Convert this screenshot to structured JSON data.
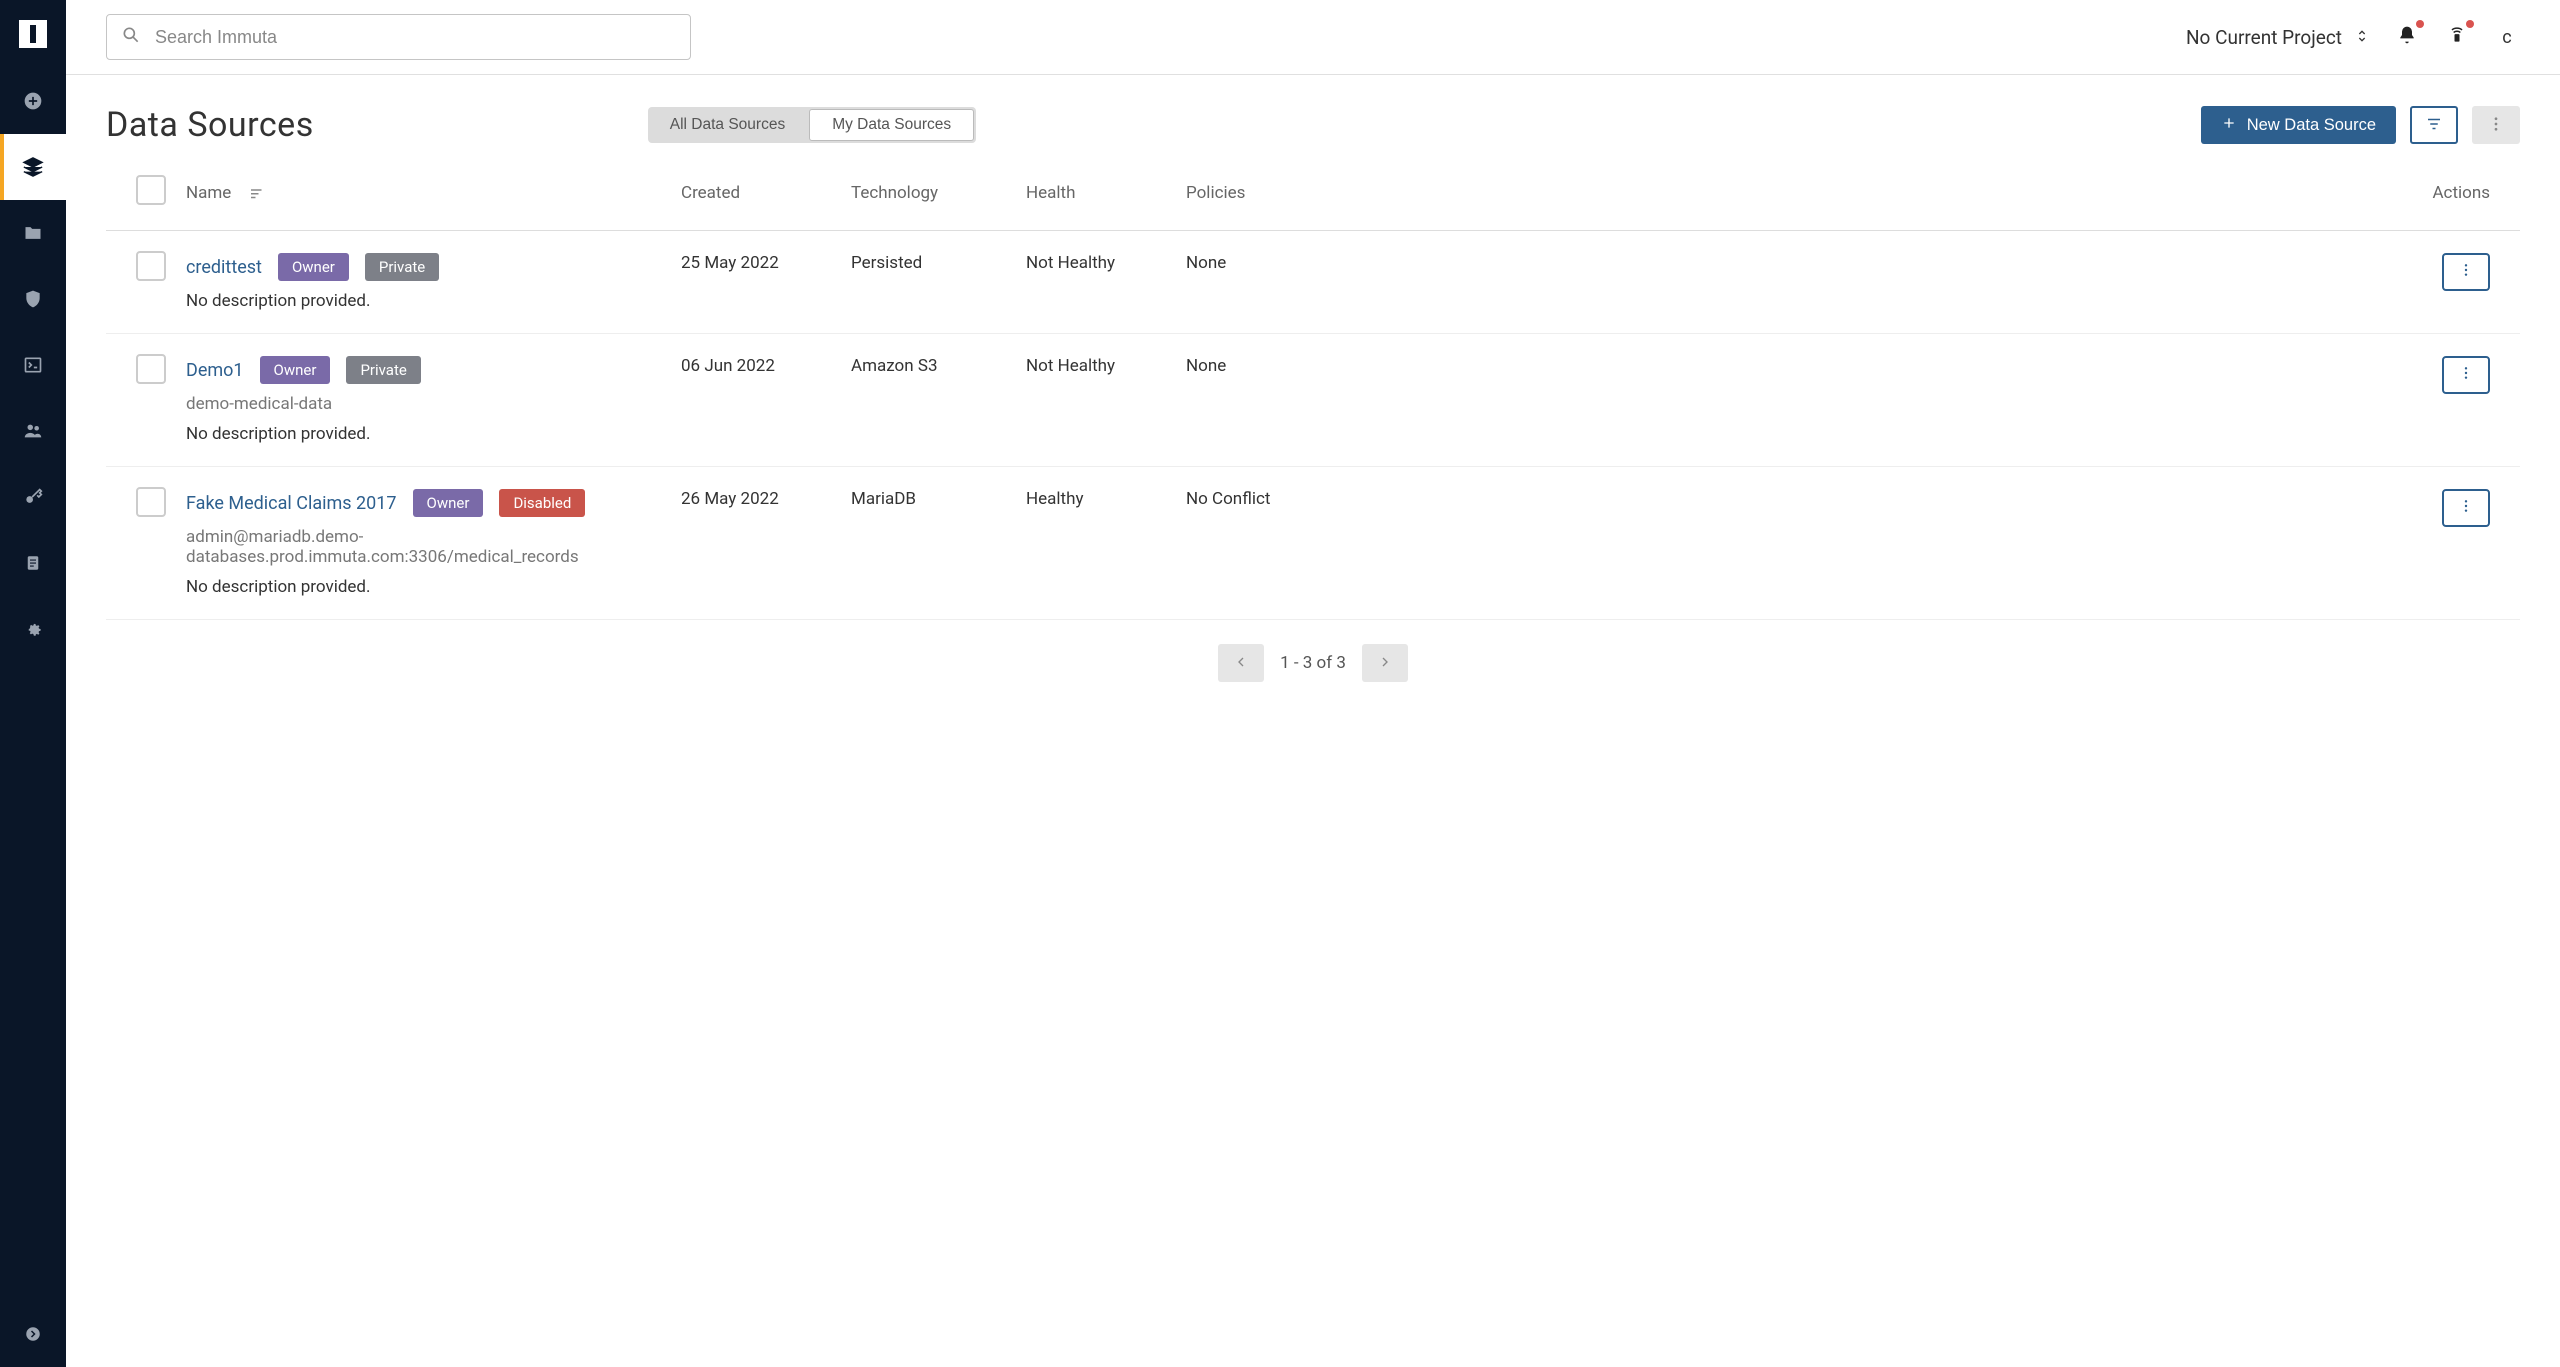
{
  "search": {
    "placeholder": "Search Immuta"
  },
  "topbar": {
    "project_label": "No Current Project",
    "avatar_letter": "c"
  },
  "page": {
    "title": "Data Sources",
    "toggle": {
      "all": "All Data Sources",
      "mine": "My Data Sources"
    },
    "new_button": "New Data Source"
  },
  "columns": {
    "name": "Name",
    "created": "Created",
    "technology": "Technology",
    "health": "Health",
    "policies": "Policies",
    "actions": "Actions"
  },
  "rows": [
    {
      "name": "credittest",
      "tags": [
        {
          "label": "Owner",
          "type": "owner"
        },
        {
          "label": "Private",
          "type": "private"
        }
      ],
      "subtext": "",
      "description": "No description provided.",
      "created": "25 May 2022",
      "technology": "Persisted",
      "health": "Not Healthy",
      "policies": "None"
    },
    {
      "name": "Demo1",
      "tags": [
        {
          "label": "Owner",
          "type": "owner"
        },
        {
          "label": "Private",
          "type": "private"
        }
      ],
      "subtext": "demo-medical-data",
      "description": "No description provided.",
      "created": "06 Jun 2022",
      "technology": "Amazon S3",
      "health": "Not Healthy",
      "policies": "None"
    },
    {
      "name": "Fake Medical Claims 2017",
      "tags": [
        {
          "label": "Owner",
          "type": "owner"
        },
        {
          "label": "Disabled",
          "type": "disabled"
        }
      ],
      "subtext": "admin@mariadb.demo-databases.prod.immuta.com:3306/medical_records",
      "description": "No description provided.",
      "created": "26 May 2022",
      "technology": "MariaDB",
      "health": "Healthy",
      "policies": "No Conflict"
    }
  ],
  "pagination": {
    "range": "1 - 3 of 3"
  }
}
